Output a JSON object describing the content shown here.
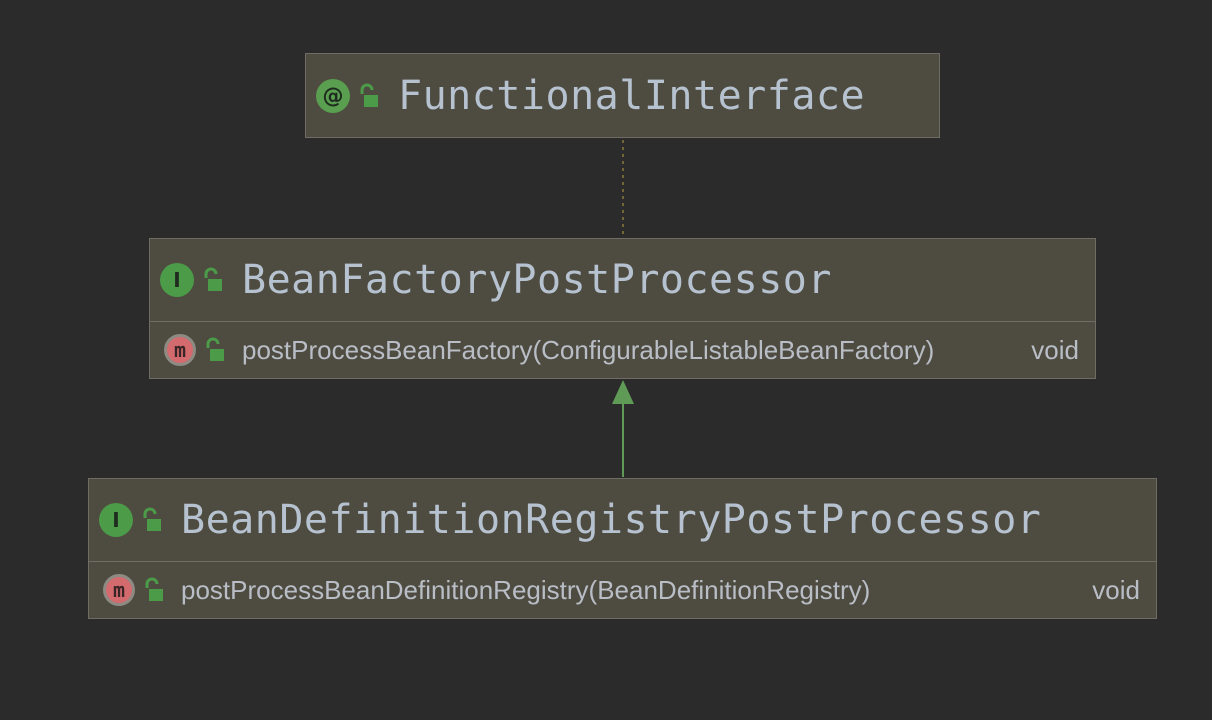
{
  "diagram": {
    "nodes": {
      "functional_interface": {
        "kind_icon": "annotation-icon",
        "kind_glyph": "@",
        "visibility_icon": "unlocked-icon",
        "title": "FunctionalInterface"
      },
      "bean_factory_post_processor": {
        "kind_icon": "interface-icon",
        "kind_glyph": "I",
        "visibility_icon": "unlocked-icon",
        "title": "BeanFactoryPostProcessor",
        "method": {
          "kind_icon": "abstract-method-icon",
          "kind_glyph": "m",
          "visibility_icon": "unlocked-icon",
          "signature": "postProcessBeanFactory(ConfigurableListableBeanFactory)",
          "return_type": "void"
        }
      },
      "bean_definition_registry_post_processor": {
        "kind_icon": "interface-icon",
        "kind_glyph": "I",
        "visibility_icon": "unlocked-icon",
        "title": "BeanDefinitionRegistryPostProcessor",
        "method": {
          "kind_icon": "abstract-method-icon",
          "kind_glyph": "m",
          "visibility_icon": "unlocked-icon",
          "signature": "postProcessBeanDefinitionRegistry(BeanDefinitionRegistry)",
          "return_type": "void"
        }
      }
    },
    "edges": [
      {
        "from": "bean_factory_post_processor",
        "to": "functional_interface",
        "style": "dotted",
        "color": "#8a7a3a"
      },
      {
        "from": "bean_definition_registry_post_processor",
        "to": "bean_factory_post_processor",
        "style": "solid-arrow",
        "color": "#5f9b56"
      }
    ],
    "colors": {
      "background": "#2b2b2b",
      "node_fill": "#4e4b40",
      "node_border": "#6e6c64",
      "title_text": "#b6c2cf",
      "interface_icon": "#4c9b48",
      "method_icon": "#d36a6e",
      "lock_icon": "#4c9b48"
    }
  }
}
